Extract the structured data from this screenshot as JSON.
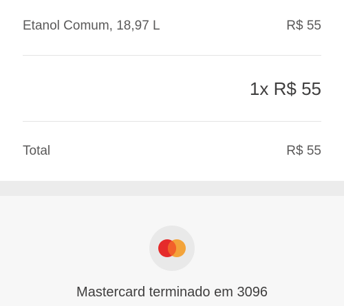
{
  "receipt": {
    "fuel_line": {
      "label": "Etanol Comum, 18,97 L",
      "price": "R$ 55"
    },
    "quantity_line": "1x R$ 55",
    "total_line": {
      "label": "Total",
      "price": "R$ 55"
    }
  },
  "payment": {
    "card_icon": "mastercard-icon",
    "card_text": "Mastercard terminado em 3096",
    "colors": {
      "red": "#e52b2b",
      "orange": "#f3a33a"
    }
  }
}
